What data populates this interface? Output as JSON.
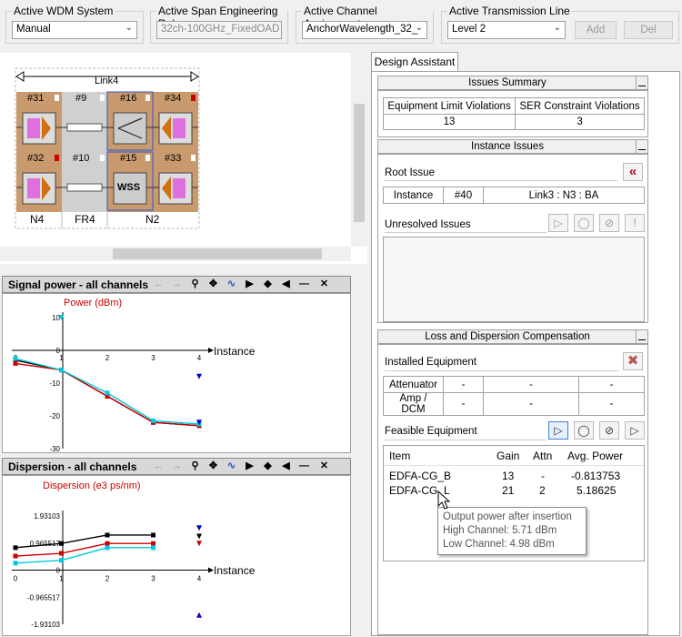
{
  "toolbar": {
    "wdm": {
      "label": "Active WDM System",
      "value": "Manual"
    },
    "span": {
      "label": "Active Span Engineering Rule",
      "value": "32ch-100GHz_FixedOAD"
    },
    "channel": {
      "label": "Active Channel Assignment",
      "value": "AnchorWavelength_32_"
    },
    "line": {
      "label": "Active Transmission Line",
      "value": "Level 2"
    },
    "add_label": "Add",
    "del_label": "Del"
  },
  "link": {
    "name": "Link4",
    "top_nodes": [
      "#31",
      "#9",
      "#16",
      "#34"
    ],
    "bottom_nodes": [
      "#32",
      "#10",
      "#15",
      "#33"
    ],
    "wss_label": "WSS",
    "sites": [
      "N4",
      "FR4",
      "N2"
    ]
  },
  "signal_chart": {
    "header": "Signal power - all channels",
    "ylabel": "Power (dBm)",
    "xlabel": "Instance",
    "yticks": [
      "10",
      "0",
      "-10",
      "-20",
      "-30"
    ],
    "xticks": [
      "0",
      "1",
      "2",
      "3",
      "4"
    ]
  },
  "disp_chart": {
    "header": "Dispersion - all channels",
    "ylabel": "Dispersion (e3 ps/nm)",
    "xlabel": "Instance",
    "yticks": [
      "1.93103",
      "0.965517",
      "0",
      "-0.965517",
      "-1.93103"
    ],
    "xticks": [
      "0",
      "1",
      "2",
      "3",
      "4"
    ]
  },
  "design_assistant": {
    "tab": "Design Assistant",
    "issues_summary": {
      "title": "Issues Summary",
      "headers": [
        "Equipment Limit Violations",
        "SER Constraint Violations"
      ],
      "values": [
        "13",
        "3"
      ]
    },
    "instance_issues": {
      "title": "Instance Issues",
      "root_issue": "Root Issue",
      "row": [
        "Instance",
        "#40",
        "Link3 : N3 : BA"
      ],
      "unresolved": "Unresolved Issues"
    },
    "loss_disp": {
      "title": "Loss and Dispersion Compensation",
      "installed": "Installed Equipment",
      "rows": [
        [
          "Attenuator",
          "-",
          "-",
          "-"
        ],
        [
          "Amp / DCM",
          "-",
          "-",
          "-"
        ]
      ],
      "feasible": "Feasible Equipment",
      "headers": [
        "Item",
        "Gain",
        "Attn",
        "Avg. Power"
      ],
      "items": [
        {
          "item": "EDFA-CG_B",
          "gain": "13",
          "attn": "-",
          "power": "-0.813753"
        },
        {
          "item": "EDFA-CG_L",
          "gain": "21",
          "attn": "2",
          "power": "5.18625"
        }
      ]
    },
    "tooltip": {
      "title": "Output power after insertion",
      "high": "High Channel:  5.71 dBm",
      "low": "Low Channel:   4.98 dBm"
    }
  },
  "chart_data": [
    {
      "type": "line",
      "title": "Signal power - all channels",
      "xlabel": "Instance",
      "ylabel": "Power (dBm)",
      "ylim": [
        -30,
        10
      ],
      "series": [
        {
          "values": [
            [
              0,
              -3
            ],
            [
              1,
              -6
            ],
            [
              2,
              -14
            ],
            [
              3,
              -22
            ],
            [
              4,
              -23
            ]
          ]
        },
        {
          "values": [
            [
              0,
              -4
            ],
            [
              1,
              -6
            ],
            [
              2,
              -14
            ],
            [
              3,
              -22
            ],
            [
              4,
              -23
            ]
          ]
        },
        {
          "values": [
            [
              0,
              -2.5
            ],
            [
              1,
              -6
            ],
            [
              2,
              -13
            ],
            [
              3,
              -21.5
            ],
            [
              4,
              -22.5
            ]
          ]
        }
      ]
    },
    {
      "type": "line",
      "title": "Dispersion - all channels",
      "xlabel": "Instance",
      "ylabel": "Dispersion (e3 ps/nm)",
      "ylim": [
        -1.93103,
        1.93103
      ],
      "series": [
        {
          "values": [
            [
              0,
              0.8
            ],
            [
              1,
              0.95
            ],
            [
              2,
              1.25
            ],
            [
              3,
              1.25
            ]
          ]
        },
        {
          "values": [
            [
              0,
              0.5
            ],
            [
              1,
              0.6
            ],
            [
              2,
              0.95
            ],
            [
              3,
              0.95
            ]
          ]
        },
        {
          "values": [
            [
              0,
              0.25
            ],
            [
              1,
              0.35
            ],
            [
              2,
              0.8
            ],
            [
              3,
              0.8
            ]
          ]
        }
      ]
    }
  ]
}
